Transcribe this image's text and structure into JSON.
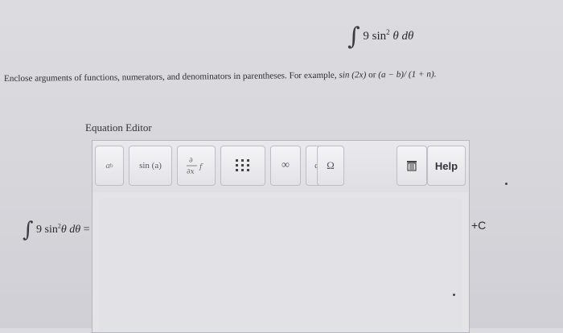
{
  "integral": {
    "sign": "∫",
    "coef": "9",
    "func": "sin",
    "exp": "2",
    "var": "θ",
    "diff": "dθ"
  },
  "instructions": {
    "text": "Enclose arguments of functions, numerators, and denominators in parentheses. For example, ",
    "example1": "sin (2x)",
    "or": " or ",
    "example2": "(a − b)/ (1 + n)."
  },
  "editor": {
    "label": "Equation Editor",
    "buttons": [
      {
        "name": "power-button",
        "label": "a",
        "sup": "b"
      },
      {
        "name": "sin-button",
        "label": "sin (a)"
      },
      {
        "name": "derivative-button",
        "label": "∂/∂x f"
      },
      {
        "name": "matrix-button",
        "label": "⋮⋮⋮"
      },
      {
        "name": "infinity-button",
        "label": "∞"
      },
      {
        "name": "alpha-button",
        "label": "α"
      },
      {
        "name": "omega-button",
        "label": "Ω"
      },
      {
        "name": "trash-button",
        "label": ""
      },
      {
        "name": "help-button",
        "label": "Help"
      }
    ]
  },
  "answer": {
    "equals": "=",
    "constant": "+C"
  }
}
